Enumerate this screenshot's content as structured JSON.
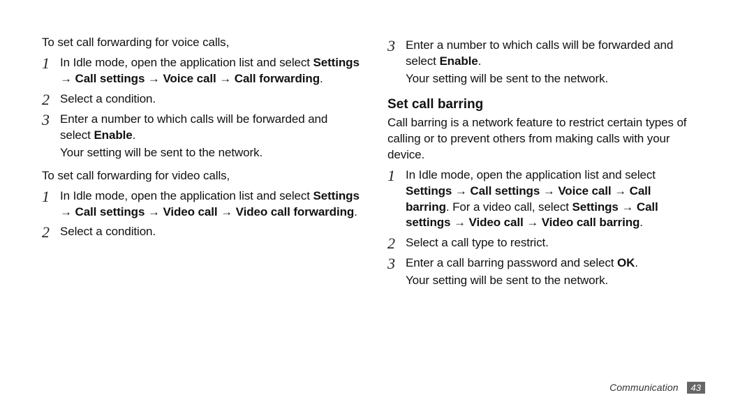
{
  "arrow": "→",
  "left": {
    "intro_voice": "To set call forwarding for voice calls,",
    "voice_steps": {
      "s1": {
        "num": "1",
        "lead": "In Idle mode, open the application list and select ",
        "path": "Settings → Call settings → Voice call → Call forwarding",
        "tail": "."
      },
      "s2": {
        "num": "2",
        "text": "Select a condition."
      },
      "s3": {
        "num": "3",
        "lead": "Enter a number to which calls will be forwarded and select ",
        "bold": "Enable",
        "tail": ".",
        "note": "Your setting will be sent to the network."
      }
    },
    "intro_video": "To set call forwarding for video calls,",
    "video_steps": {
      "s1": {
        "num": "1",
        "lead": "In Idle mode, open the application list and select ",
        "path": "Settings → Call settings → Video call → Video call forwarding",
        "tail": "."
      },
      "s2": {
        "num": "2",
        "text": "Select a condition."
      }
    }
  },
  "right": {
    "cont_step3": {
      "num": "3",
      "lead": "Enter a number to which calls will be forwarded and select ",
      "bold": "Enable",
      "tail": ".",
      "note": "Your setting will be sent to the network."
    },
    "heading": "Set call barring",
    "desc": "Call barring is a network feature to restrict certain types of calling or to prevent others from making calls with your device.",
    "steps": {
      "s1": {
        "num": "1",
        "lead": "In Idle mode, open the application list and select ",
        "path1": "Settings → Call settings → Voice call → Call barring",
        "mid": ". For a video call, select ",
        "path2a": "Settings → Call settings → Video call → Video call barring",
        "tail2": "."
      },
      "s2": {
        "num": "2",
        "text": "Select a call type to restrict."
      },
      "s3": {
        "num": "3",
        "lead": "Enter a call barring password and select ",
        "bold": "OK",
        "tail": ".",
        "note": "Your setting will be sent to the network."
      }
    }
  },
  "footer": {
    "section": "Communication",
    "page": "43"
  }
}
